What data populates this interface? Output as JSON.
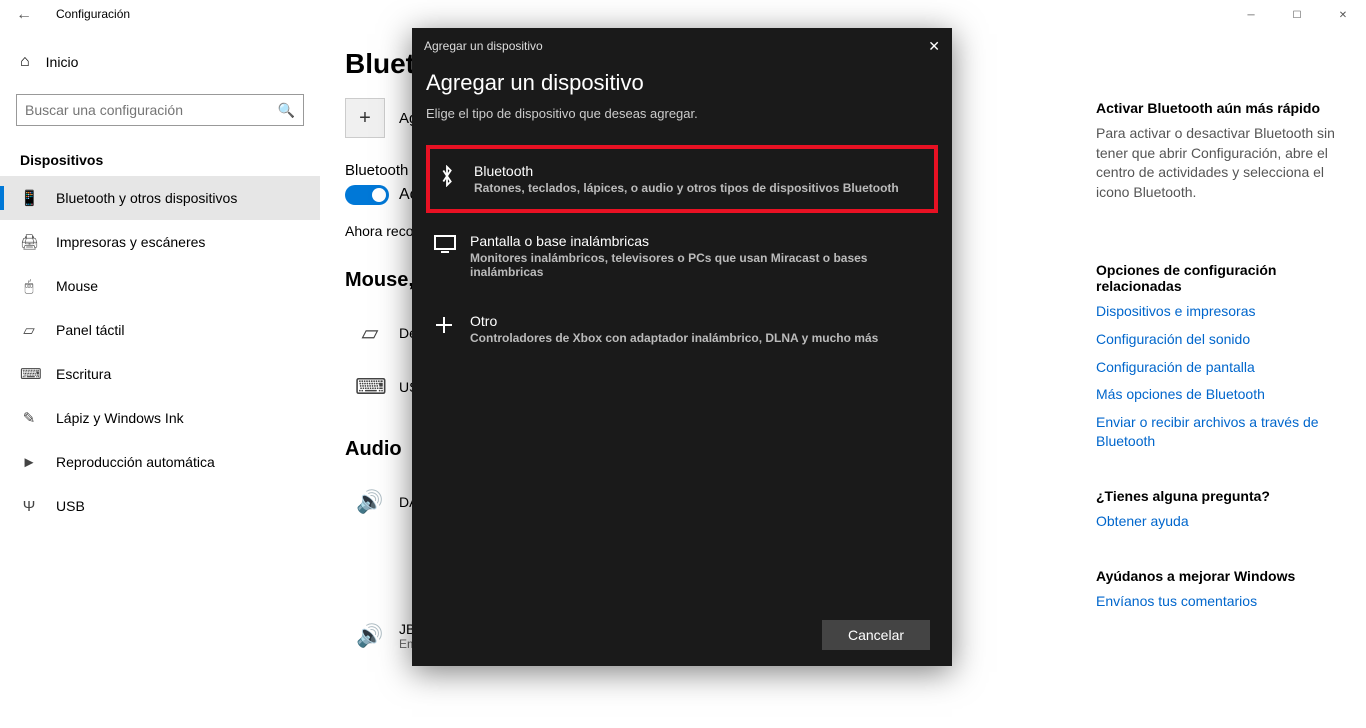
{
  "titlebar": {
    "title": "Configuración"
  },
  "sidebar": {
    "home_label": "Inicio",
    "search_placeholder": "Buscar una configuración",
    "section_label": "Dispositivos",
    "items": [
      {
        "label": "Bluetooth y otros dispositivos"
      },
      {
        "label": "Impresoras y escáneres"
      },
      {
        "label": "Mouse"
      },
      {
        "label": "Panel táctil"
      },
      {
        "label": "Escritura"
      },
      {
        "label": "Lápiz y Windows Ink"
      },
      {
        "label": "Reproducción automática"
      },
      {
        "label": "USB"
      }
    ]
  },
  "main": {
    "heading": "Bluetooth y otros dispositivos",
    "add_label": "Agregar Bluetooth u otro dispositivo",
    "bt_label": "Bluetooth",
    "bt_state": "Activado",
    "status": "Ahora reconocible como …",
    "groups": {
      "mouse_title": "Mouse, teclado y lápiz",
      "audio_title": "Audio"
    },
    "devices": {
      "dell": "Dell …",
      "usb": "USB …",
      "da": "DA…",
      "jbl_name": "JBL Xtreme",
      "jbl_status": "Emparejado"
    }
  },
  "aside": {
    "tip_title": "Activar Bluetooth aún más rápido",
    "tip_body": "Para activar o desactivar Bluetooth sin tener que abrir Configuración, abre el centro de actividades y selecciona el icono Bluetooth.",
    "related_title": "Opciones de configuración relacionadas",
    "links": [
      "Dispositivos e impresoras",
      "Configuración del sonido",
      "Configuración de pantalla",
      "Más opciones de Bluetooth",
      "Enviar o recibir archivos a través de Bluetooth"
    ],
    "question_title": "¿Tienes alguna pregunta?",
    "help_link": "Obtener ayuda",
    "improve_title": "Ayúdanos a mejorar Windows",
    "feedback_link": "Envíanos tus comentarios"
  },
  "dialog": {
    "window_title": "Agregar un dispositivo",
    "heading": "Agregar un dispositivo",
    "subtitle": "Elige el tipo de dispositivo que deseas agregar.",
    "options": [
      {
        "title": "Bluetooth",
        "desc": "Ratones, teclados, lápices, o audio y otros tipos de dispositivos Bluetooth"
      },
      {
        "title": "Pantalla o base inalámbricas",
        "desc": "Monitores inalámbricos, televisores o PCs que usan Miracast o bases inalámbricas"
      },
      {
        "title": "Otro",
        "desc": "Controladores de Xbox con adaptador inalámbrico, DLNA y mucho más"
      }
    ],
    "cancel": "Cancelar"
  }
}
